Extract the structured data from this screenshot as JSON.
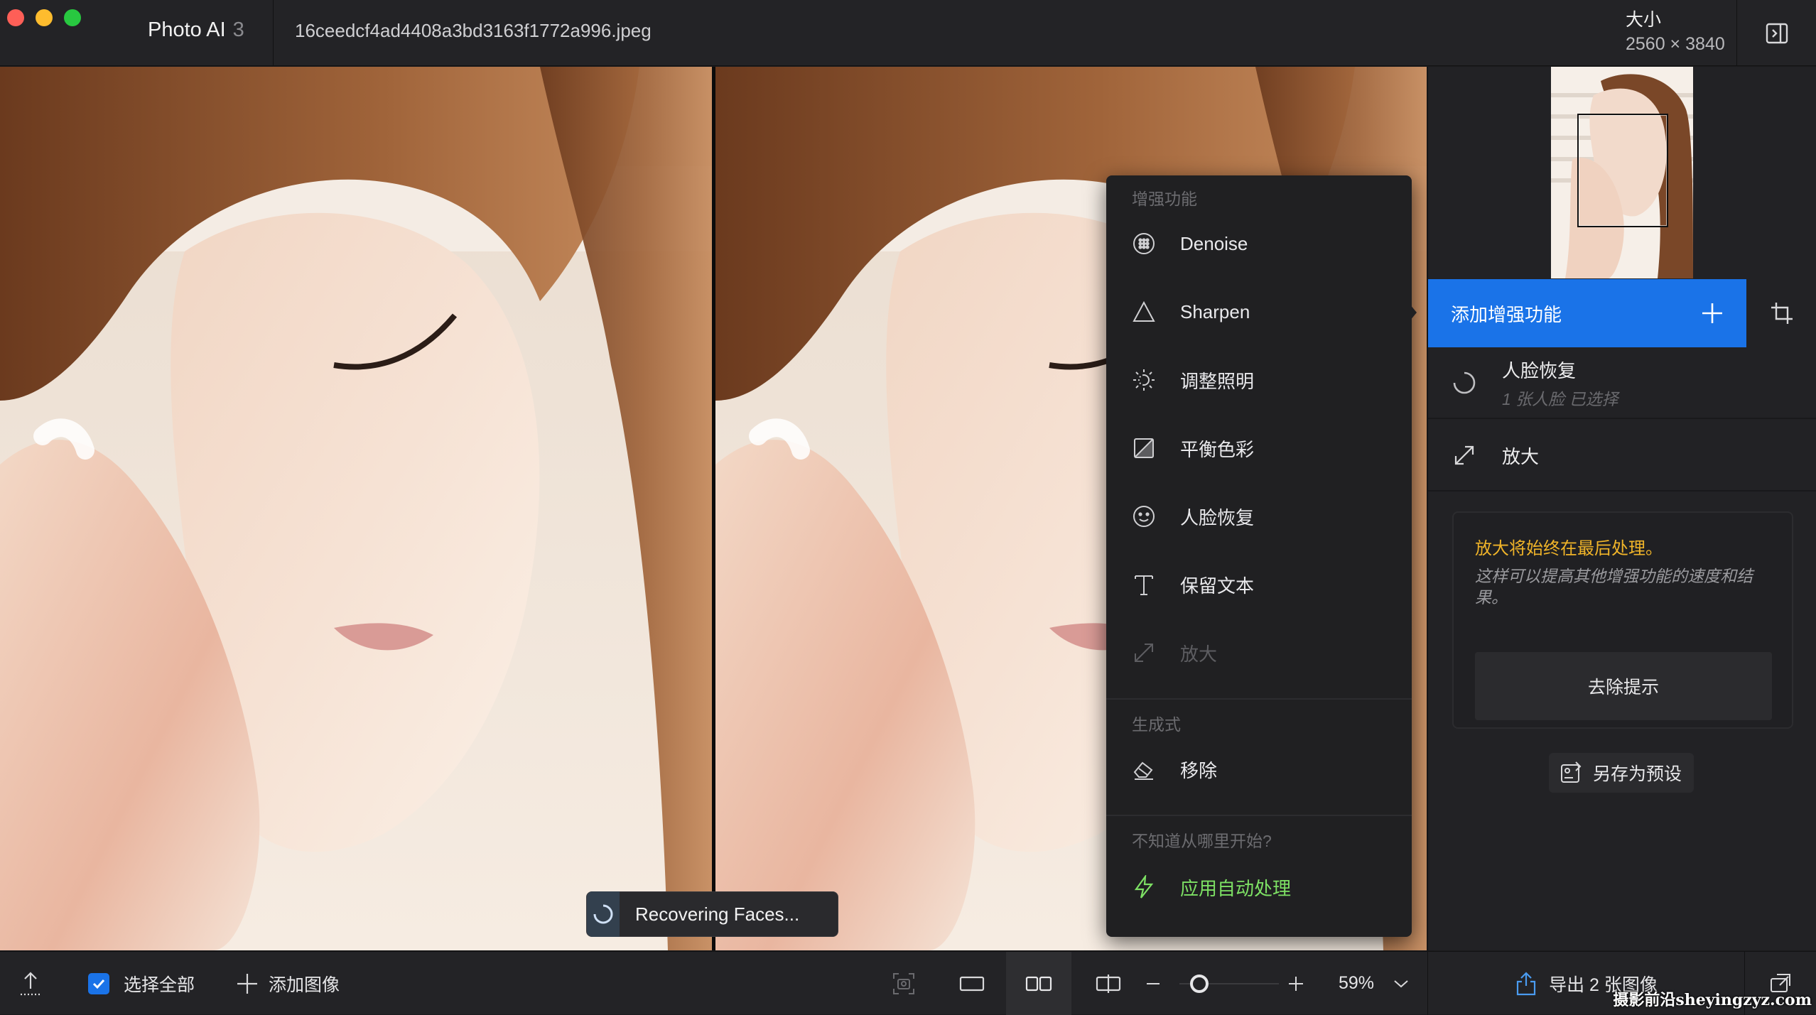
{
  "window": {
    "app_name": "Photo AI",
    "app_version": "3",
    "filename": "16ceedcf4ad4408a3bd3163f1772a996.jpeg",
    "size_label": "大小",
    "size_value": "2560 × 3840"
  },
  "menu": {
    "section_enhance": "增强功能",
    "items": [
      {
        "label": "Denoise",
        "icon": "denoise-icon"
      },
      {
        "label": "Sharpen",
        "icon": "sharpen-icon"
      },
      {
        "label": "调整照明",
        "icon": "lighting-icon"
      },
      {
        "label": "平衡色彩",
        "icon": "color-balance-icon"
      },
      {
        "label": "人脸恢复",
        "icon": "face-icon"
      },
      {
        "label": "保留文本",
        "icon": "text-icon"
      },
      {
        "label": "放大",
        "icon": "upscale-icon",
        "disabled": true
      }
    ],
    "section_generative": "生成式",
    "remove_label": "移除",
    "section_help": "不知道从哪里开始?",
    "auto_label": "应用自动处理"
  },
  "toast": {
    "text": "Recovering Faces..."
  },
  "sidepanel": {
    "add_enhancement": "添加增强功能",
    "face_recovery_title": "人脸恢复",
    "face_recovery_sub": "1 张人脸 已选择",
    "upscale_title": "放大",
    "tip_title": "放大将始终在最后处理。",
    "tip_body": "这样可以提高其他增强功能的速度和结果。",
    "tip_dismiss": "去除提示",
    "save_preset": "另存为预设"
  },
  "bottombar": {
    "select_all": "选择全部",
    "select_all_checked": true,
    "add_images": "添加图像",
    "zoom": "59%",
    "zoom_fraction": 0.2,
    "export": "导出 2 张图像"
  },
  "watermark": "摄影前沿sheyingzyz.com",
  "colors": {
    "accent": "#1a73e8",
    "auto_green": "#7de064",
    "tip_yellow": "#f0b429"
  }
}
